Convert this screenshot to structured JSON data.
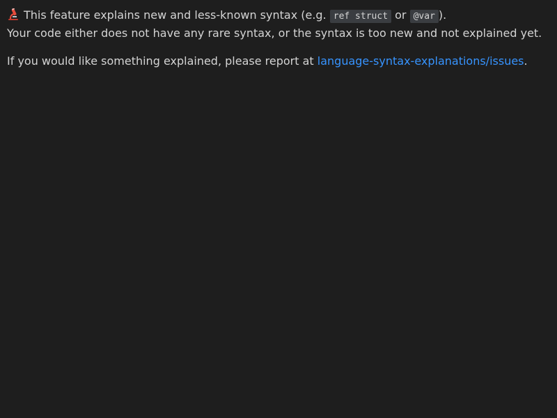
{
  "notice": {
    "icon": "microscope-icon",
    "intro_text": "This feature explains new and less-known syntax (e.g.",
    "example_1": "ref struct",
    "or_text": "or",
    "example_2": "@var",
    "intro_close": ").",
    "status_text": "Your code either does not have any rare syntax, or the syntax is too new and not explained yet."
  },
  "report": {
    "prefix_text": "If you would like something explained, please report at",
    "link_text": "language-syntax-explanations/issues",
    "suffix_text": "."
  },
  "colors": {
    "background": "#1e1e1e",
    "text": "#d4d4d4",
    "link": "#3794ff",
    "code_background": "#3a3d41"
  }
}
